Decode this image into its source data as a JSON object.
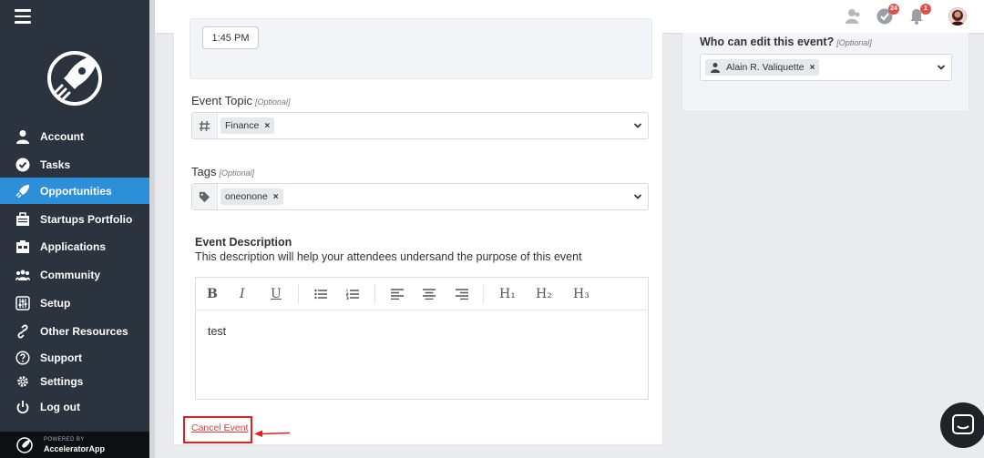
{
  "sidebar": {
    "items": [
      {
        "label": "Account",
        "icon": "user-icon",
        "active": false
      },
      {
        "label": "Tasks",
        "icon": "check-circle-icon",
        "active": false
      },
      {
        "label": "Opportunities",
        "icon": "rocket-icon",
        "active": true
      },
      {
        "label": "Startups Portfolio",
        "icon": "briefcase-icon",
        "active": false
      },
      {
        "label": "Applications",
        "icon": "clipboard-icon",
        "active": false
      },
      {
        "label": "Community",
        "icon": "users-icon",
        "active": false
      },
      {
        "label": "Setup",
        "icon": "sliders-icon",
        "active": false
      },
      {
        "label": "Other Resources",
        "icon": "link-icon",
        "active": false
      },
      {
        "label": "Support",
        "icon": "question-circle-icon",
        "active": false
      },
      {
        "label": "Settings",
        "icon": "gear-icon",
        "active": false
      },
      {
        "label": "Log out",
        "icon": "power-icon",
        "active": false
      }
    ],
    "powered_by": "POWERED BY",
    "powered_brand": "AcceleratorApp"
  },
  "topbar": {
    "tasks_badge": "24",
    "notifications_badge": "1"
  },
  "form": {
    "time_value": "1:45 PM",
    "event_topic": {
      "label": "Event Topic",
      "optional": "[Optional]",
      "chip": "Finance"
    },
    "tags": {
      "label": "Tags",
      "optional": "[Optional]",
      "chip": "oneonone"
    },
    "description": {
      "title": "Event Description",
      "subtitle": "This description will help your attendees undersand the purpose of this event",
      "text": "test"
    },
    "cancel_label": "Cancel Event"
  },
  "editor_toolbar": {
    "bold": "B",
    "italic": "I",
    "underline": "U",
    "h1": "H₁",
    "h2": "H₂",
    "h3": "H₃"
  },
  "right": {
    "who_label": "Who can edit this event?",
    "optional": "[Optional]",
    "chip": "Alain R. Valiquette"
  },
  "colors": {
    "sidebar_bg": "#2b333e",
    "active_blue": "#2d8fd8",
    "cancel_red": "#e02020"
  }
}
